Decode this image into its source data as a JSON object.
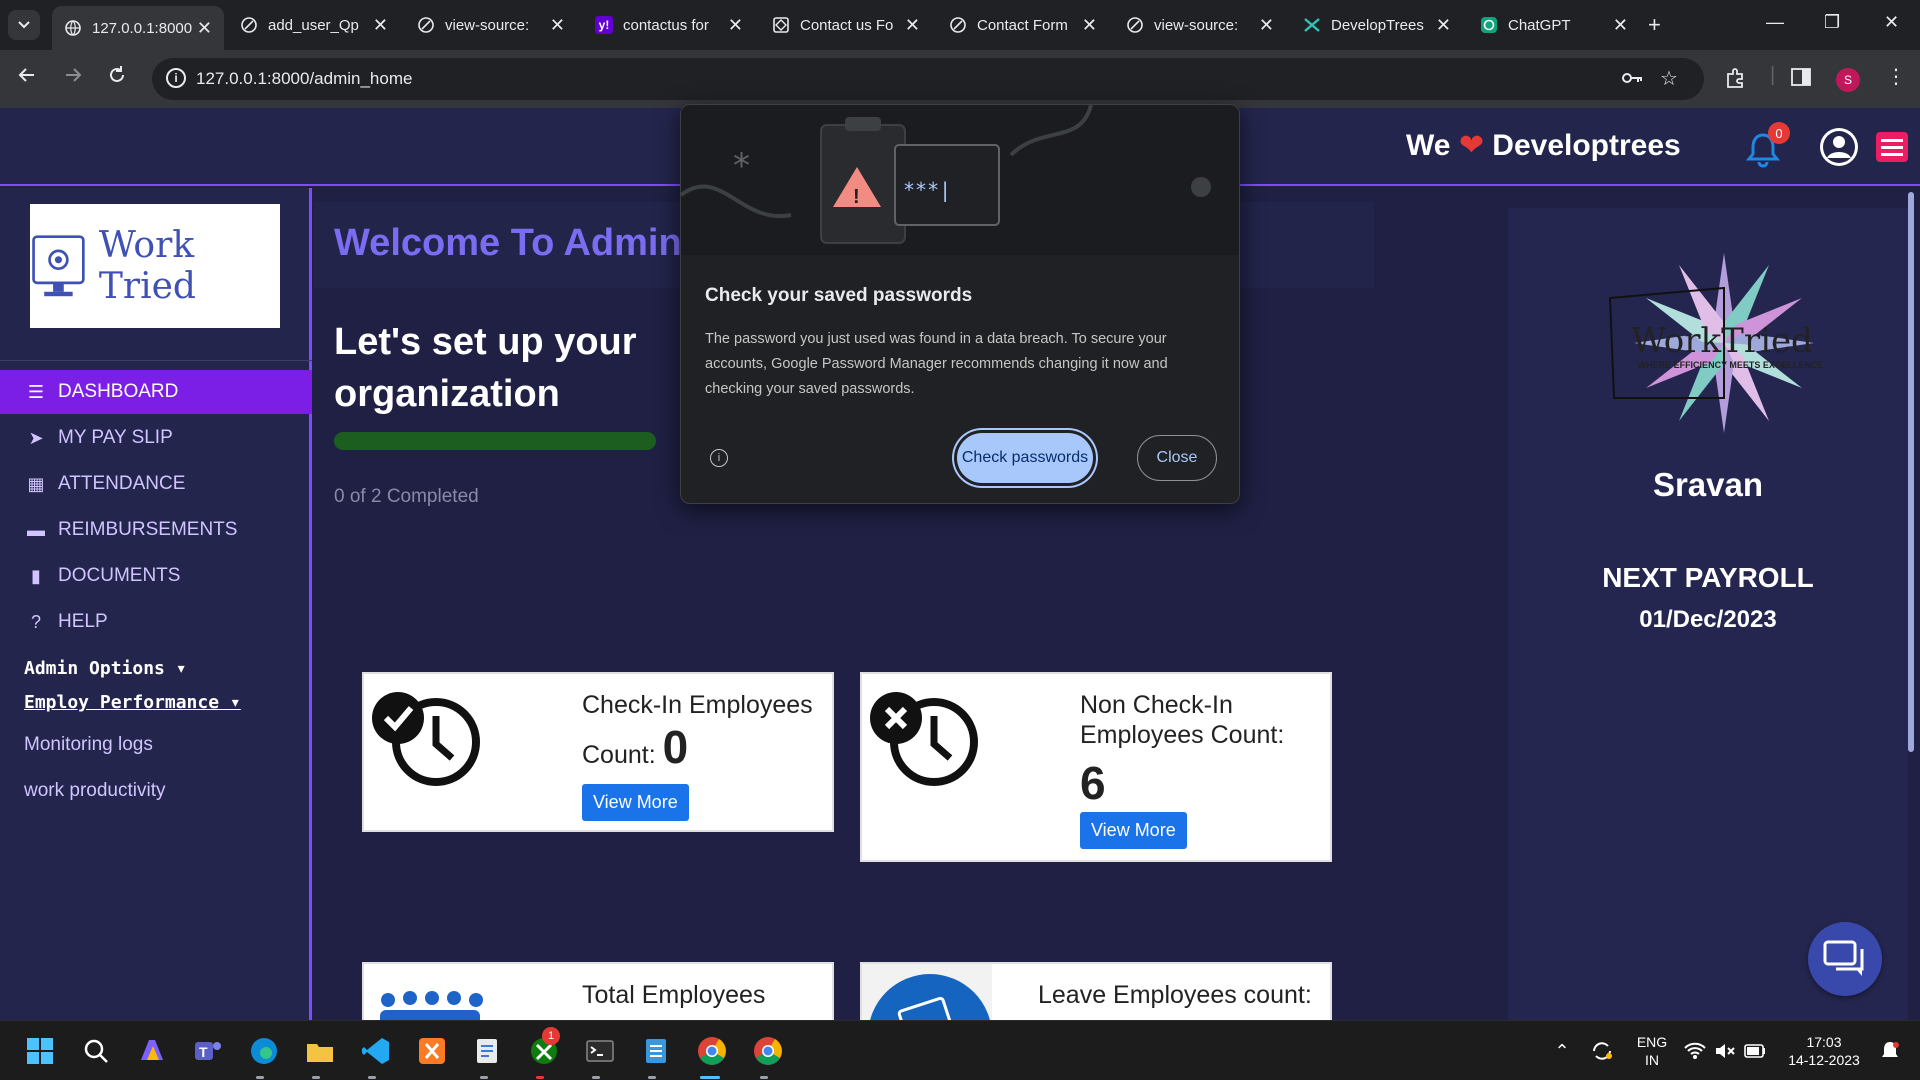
{
  "browser": {
    "tabs": [
      {
        "title": "127.0.0.1:8000",
        "active": true
      },
      {
        "title": "add_user_Qp"
      },
      {
        "title": "view-source:"
      },
      {
        "title": "contactus for"
      },
      {
        "title": "Contact us Fo"
      },
      {
        "title": "Contact Form"
      },
      {
        "title": "view-source:"
      },
      {
        "title": "DevelopTrees"
      },
      {
        "title": "ChatGPT"
      }
    ],
    "url": "127.0.0.1:8000/admin_home",
    "profile_initial": "S"
  },
  "navbar": {
    "brand_prefix": "We",
    "brand_name": "Developtrees",
    "notification_count": "0"
  },
  "sidebar": {
    "logo_text": "Work Tried",
    "items": [
      {
        "label": "DASHBOARD",
        "icon": "bars-icon",
        "active": true
      },
      {
        "label": "MY PAY SLIP",
        "icon": "paper-plane-icon"
      },
      {
        "label": "ATTENDANCE",
        "icon": "calendar-icon"
      },
      {
        "label": "REIMBURSEMENTS",
        "icon": "credit-card-icon"
      },
      {
        "label": "DOCUMENTS",
        "icon": "file-icon"
      },
      {
        "label": "HELP",
        "icon": "question-circle-icon"
      }
    ],
    "admin_options": "Admin Options",
    "employ_performance": "Employ Performance",
    "sub_items": [
      "Monitoring logs",
      "work productivity"
    ]
  },
  "main": {
    "welcome": "Welcome To Admin",
    "setup_title": "Let's set up your organization",
    "progress_fraction": 0.0,
    "completed_text": "0 of 2 Completed",
    "cards": [
      {
        "title": "Check-In Employees",
        "count_label": "Count:",
        "count": "0",
        "button": "View More"
      },
      {
        "title": "Non Check-In Employees Count:",
        "count": "6",
        "button": "View More"
      },
      {
        "title": "Total Employees"
      },
      {
        "title": "Leave Employees count:"
      }
    ]
  },
  "right_panel": {
    "logo_text": "WorkTried",
    "logo_tagline": "WHERE EFFICIENCY MEETS EXCELLENCE!",
    "user_name": "Sravan",
    "payroll_label": "NEXT PAYROLL",
    "payroll_date": "01/Dec/2023"
  },
  "popup": {
    "title": "Check your saved passwords",
    "body": "The password you just used was found in a data breach. To secure your accounts, Google Password Manager recommends changing it now and checking your saved passwords.",
    "primary_button": "Check passwords",
    "secondary_button": "Close",
    "hero_mask": "***|"
  },
  "taskbar": {
    "lang_top": "ENG",
    "lang_bottom": "IN",
    "time": "17:03",
    "date": "14-12-2023",
    "xbox_badge": "1"
  },
  "colors": {
    "page_bg": "#1f2044",
    "accent": "#7c4dff",
    "active_item": "#7b1fe6",
    "button_blue": "#1a73e8",
    "popup_primary": "#a8c7fa"
  }
}
